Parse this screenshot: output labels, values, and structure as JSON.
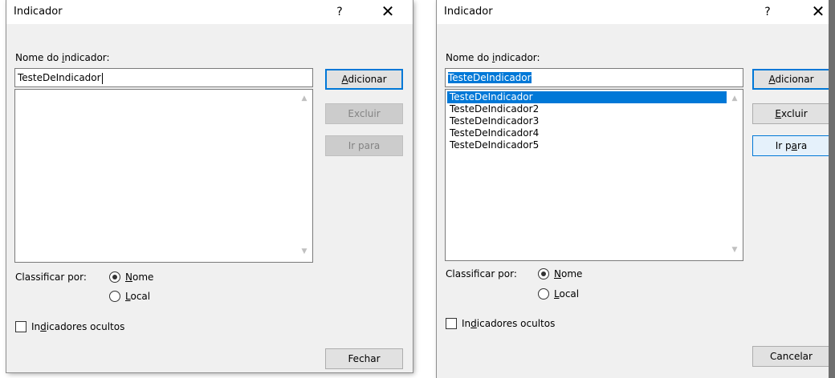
{
  "dialogs": [
    {
      "title": "Indicador",
      "help": "?",
      "close": "✕",
      "name_label_pre": "Nome do ",
      "name_label_u": "i",
      "name_label_post": "ndicador:",
      "name_value": "TesteDeIndicador",
      "list_items": [],
      "buttons": {
        "add_u": "A",
        "add_rest": "dicionar",
        "delete": "Excluir",
        "goto": "Ir para",
        "bottom": "Fechar"
      },
      "sort_label": "Classificar por:",
      "sort_options": [
        {
          "u": "N",
          "rest": "ome"
        },
        {
          "u": "L",
          "rest": "ocal"
        }
      ],
      "hidden_pre": "In",
      "hidden_u": "d",
      "hidden_post": "icadores ocultos"
    },
    {
      "title": "Indicador",
      "help": "?",
      "close": "✕",
      "name_label_pre": "Nome do ",
      "name_label_u": "i",
      "name_label_post": "ndicador:",
      "name_value": "TesteDeIndicador",
      "list_items": [
        "TesteDeIndicador",
        "TesteDeIndicador2",
        "TesteDeIndicador3",
        "TesteDeIndicador4",
        "TesteDeIndicador5"
      ],
      "buttons": {
        "add_u": "A",
        "add_rest": "dicionar",
        "delete_u": "E",
        "delete_rest": "xcluir",
        "goto_pre": "Ir p",
        "goto_u": "a",
        "goto_post": "ra",
        "bottom": "Cancelar"
      },
      "sort_label": "Classificar por:",
      "sort_options": [
        {
          "u": "N",
          "rest": "ome"
        },
        {
          "u": "L",
          "rest": "ocal"
        }
      ],
      "hidden_pre": "In",
      "hidden_u": "d",
      "hidden_post": "icadores ocultos"
    }
  ]
}
